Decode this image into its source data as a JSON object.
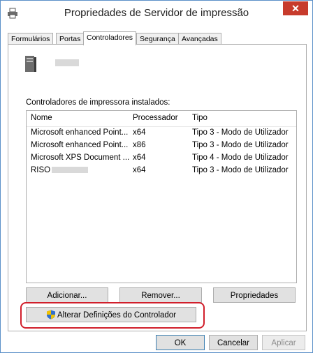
{
  "window": {
    "title": "Propriedades de Servidor de impressão",
    "close_label": "✕"
  },
  "tabs": [
    {
      "label": "Formulários"
    },
    {
      "label": "Portas"
    },
    {
      "label": "Controladores"
    },
    {
      "label": "Segurança"
    },
    {
      "label": "Avançadas"
    }
  ],
  "active_tab": "Controladores",
  "panel": {
    "installed_label": "Controladores de impressora instalados:",
    "columns": [
      "Nome",
      "Processador",
      "Tipo"
    ],
    "rows": [
      {
        "name": "Microsoft enhanced Point...",
        "processor": "x64",
        "type": "Tipo 3 - Modo de Utilizador"
      },
      {
        "name": "Microsoft enhanced Point...",
        "processor": "x86",
        "type": "Tipo 3 - Modo de Utilizador"
      },
      {
        "name": "Microsoft XPS Document ...",
        "processor": "x64",
        "type": "Tipo 4 - Modo de Utilizador"
      },
      {
        "name": "RISO",
        "processor": "x64",
        "type": "Tipo 3 - Modo de Utilizador"
      }
    ],
    "buttons": {
      "add": "Adicionar...",
      "remove": "Remover...",
      "properties": "Propriedades",
      "change_settings": "Alterar Definições do Controlador"
    }
  },
  "footer": {
    "ok": "OK",
    "cancel": "Cancelar",
    "apply": "Aplicar"
  },
  "icons": {
    "app": "printer-icon",
    "server": "server-icon",
    "shield": "uac-shield-icon"
  },
  "colors": {
    "highlight": "#d11f2b",
    "close": "#c73b2c",
    "border": "#5b90c8"
  }
}
